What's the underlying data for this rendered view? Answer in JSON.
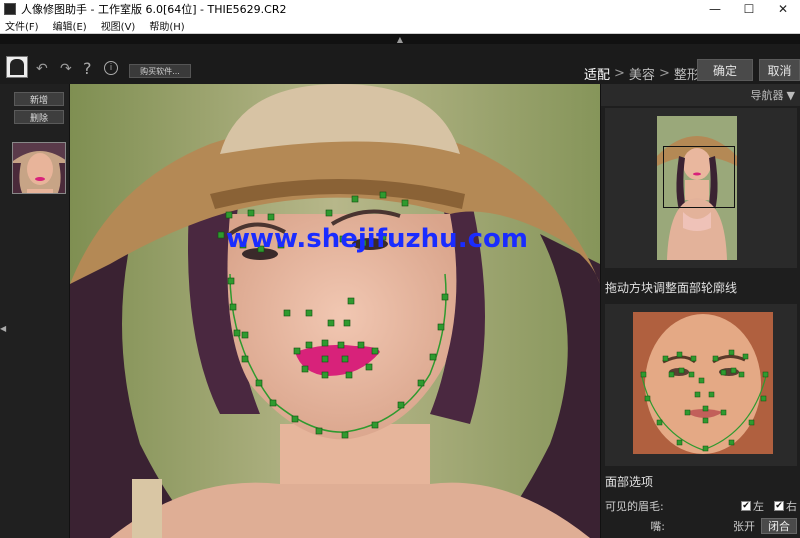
{
  "window": {
    "title": "人像修图助手 - 工作室版 6.0[64位] - THIE5629.CR2",
    "minimize": "—",
    "maximize": "☐",
    "close": "✕"
  },
  "menu": [
    "文件(F)",
    "编辑(E)",
    "视图(V)",
    "帮助(H)"
  ],
  "toolbar": {
    "undo": "↶",
    "redo": "↷",
    "help": "?",
    "info": "i",
    "buy_label": "购买软件...",
    "steps": [
      "适配",
      "美容",
      "整形"
    ],
    "step_separator": ">",
    "active_step": 0,
    "ok_label": "确定",
    "cancel_label": "取消"
  },
  "left_panel": {
    "new_label": "新增",
    "delete_label": "删除",
    "collapse": "◀"
  },
  "main": {
    "watermark": "www.shejifuzhu.com",
    "collapse_top": "▲"
  },
  "right_panel": {
    "navigator_label": "导航器",
    "navigator_arrow": "▼",
    "instruction": "拖动方块调整面部轮廓线",
    "face_options_title": "面部选项",
    "eyebrows_label": "可见的眉毛:",
    "left_label": "左",
    "right_label": "右",
    "left_checked": true,
    "right_checked": true,
    "check_mark": "✔",
    "mouth_label": "嘴:",
    "mouth_open": "张开",
    "mouth_closed": "闭合",
    "mouth_selected": "闭合"
  },
  "colors": {
    "landmark": "#2f9a2f",
    "watermark": "#1a2cff",
    "lips": "#d8227a"
  }
}
